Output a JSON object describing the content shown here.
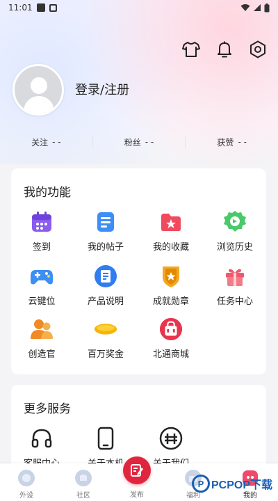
{
  "status_bar": {
    "time": "11:01"
  },
  "header": {
    "login_label": "登录/注册",
    "icons": [
      "tshirt-icon",
      "bell-icon",
      "settings-icon"
    ]
  },
  "stats": [
    {
      "label": "关注",
      "value": "- -"
    },
    {
      "label": "粉丝",
      "value": "- -"
    },
    {
      "label": "获赞",
      "value": "- -"
    }
  ],
  "functions": {
    "title": "我的功能",
    "items": [
      {
        "label": "签到",
        "icon": "calendar-icon"
      },
      {
        "label": "我的帖子",
        "icon": "post-icon"
      },
      {
        "label": "我的收藏",
        "icon": "favorite-folder-icon"
      },
      {
        "label": "浏览历史",
        "icon": "history-icon"
      },
      {
        "label": "云键位",
        "icon": "gamepad-icon"
      },
      {
        "label": "产品说明",
        "icon": "document-icon"
      },
      {
        "label": "成就勋章",
        "icon": "medal-icon"
      },
      {
        "label": "任务中心",
        "icon": "gift-icon"
      },
      {
        "label": "创造官",
        "icon": "creator-icon"
      },
      {
        "label": "百万奖金",
        "icon": "bonus-icon"
      },
      {
        "label": "北通商城",
        "icon": "shop-icon"
      }
    ]
  },
  "more_services": {
    "title": "更多服务",
    "items": [
      {
        "label": "客服中心",
        "icon": "headphones-icon"
      },
      {
        "label": "关于本机",
        "icon": "phone-icon"
      },
      {
        "label": "关于我们",
        "icon": "about-icon"
      }
    ]
  },
  "tabbar": {
    "items": [
      {
        "label": "外设"
      },
      {
        "label": "社区"
      },
      {
        "label": "发布"
      },
      {
        "label": "福利"
      },
      {
        "label": "我的"
      }
    ]
  },
  "watermark": {
    "text": "PCPOP下载"
  },
  "colors": {
    "accent": "#e0263f",
    "card_bg": "#ffffff",
    "page_bg": "#f4f4f6"
  }
}
